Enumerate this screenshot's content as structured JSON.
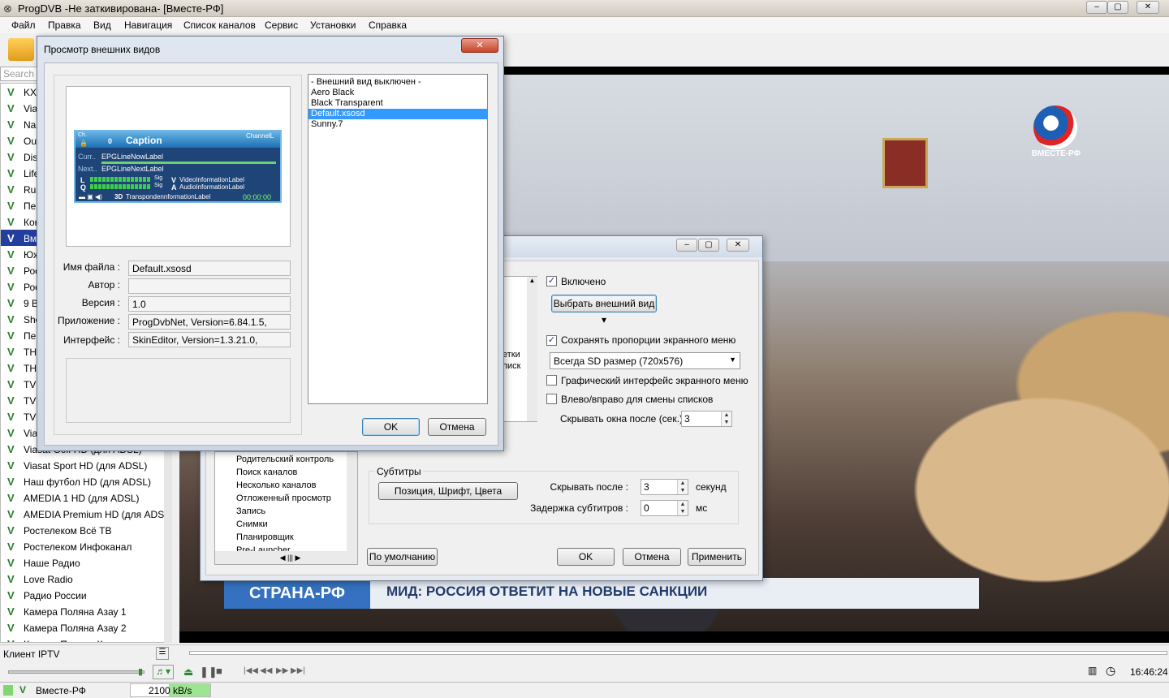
{
  "app": {
    "title": "ProgDVB -Не заткивирована-  [Вместе-РФ]"
  },
  "menu": [
    "Файл",
    "Правка",
    "Вид",
    "Навигация",
    "Список каналов",
    "Сервис",
    "Установки",
    "Справка"
  ],
  "search": {
    "placeholder": "Search c"
  },
  "channels": [
    {
      "name": "KXI"
    },
    {
      "name": "Via"
    },
    {
      "name": "Nau"
    },
    {
      "name": "Out"
    },
    {
      "name": "Dis"
    },
    {
      "name": "Life"
    },
    {
      "name": "Rus"
    },
    {
      "name": "Пер"
    },
    {
      "name": "Кон"
    },
    {
      "name": "Вме",
      "selected": true
    },
    {
      "name": "Юж"
    },
    {
      "name": "Рос"
    },
    {
      "name": "Рос"
    },
    {
      "name": "9 В"
    },
    {
      "name": "Sho"
    },
    {
      "name": "Пер"
    },
    {
      "name": "ТНТ"
    },
    {
      "name": "ТНТ"
    },
    {
      "name": "TV1"
    },
    {
      "name": "TV1"
    },
    {
      "name": "TV1"
    },
    {
      "name": "Via"
    },
    {
      "name": "Viasat Golf HD (для ADSL)"
    },
    {
      "name": "Viasat Sport HD (для ADSL)"
    },
    {
      "name": "Наш футбол HD (для ADSL)"
    },
    {
      "name": "AMEDIA 1 HD (для ADSL)"
    },
    {
      "name": "AMEDIA Premium HD (для ADS.."
    },
    {
      "name": "Ростелеком Всё ТВ"
    },
    {
      "name": "Ростелеком Инфоканал"
    },
    {
      "name": "Наше Радио"
    },
    {
      "name": "Love Radio"
    },
    {
      "name": "Радио России"
    },
    {
      "name": "Камера Поляна Азау 1"
    },
    {
      "name": "Камера Поляна Азау 2"
    },
    {
      "name": "Камера Поляна К..."
    }
  ],
  "video": {
    "logo": "ВМЕСТЕ-РФ",
    "ticker_left": "СТРАНА-РФ",
    "ticker_right": "МИД: РОССИЯ ОТВЕТИТ НА НОВЫЕ САНКЦИИ"
  },
  "bottom": {
    "source": "Клиент IPTV",
    "clock": "16:46:24",
    "channel": "Вместе-РФ",
    "bitrate": "2100 kB/s"
  },
  "skin_dialog": {
    "title": "Просмотр внешних видов",
    "close": "✕",
    "osd": {
      "ch": "Ch.",
      "num": "0",
      "caption": "Caption",
      "channel": "ChannelL",
      "curr": "Curr..",
      "now": "EPGLineNowLabel",
      "next": "Next..",
      "next_label": "EPGLineNextLabel",
      "vinfo": "VideoInformationLabel",
      "ainfo": "AudioInformationLabel",
      "tinfo": "TranspondennformationLabel",
      "time": "00:00:00",
      "sig": "Sig",
      "l": "L",
      "q": "Q",
      "v": "V",
      "a": "A",
      "d3": "3D"
    },
    "fields": {
      "filename_label": "Имя файла :",
      "filename": "Default.xsosd",
      "author_label": "Автор :",
      "author": "",
      "version_label": "Версия :",
      "version": "1.0",
      "app_label": "Приложение :",
      "app": "ProgDvbNet, Version=6.84.1.5,",
      "iface_label": "Интерфейс :",
      "iface": "SkinEditor, Version=1.3.21.0,"
    },
    "skins": [
      "- Внешний вид выключен -",
      "Aero Black",
      "Black Transparent",
      "Default.xsosd",
      "Sunny.7"
    ],
    "selected_skin": 3,
    "ok": "OK",
    "cancel": "Отмена"
  },
  "settings_dialog": {
    "enabled": "Включено",
    "choose_skin": "Выбрать внешний вид",
    "keep_aspect": "Сохранять пропорции экранного меню",
    "size_option": "Всегда SD размер (720x576)",
    "graphic_ui": "Графический интерфейс экранного меню",
    "left_right": "Влево/вправо для смены списков",
    "hide_after_label": "Скрывать окна после (сек.)",
    "hide_after": "3",
    "partial_1": "етки",
    "partial_2": "писк",
    "tree": [
      "Родительский контроль",
      "Поиск каналов",
      "Несколько каналов",
      "Отложенный просмотр",
      "Запись",
      "Снимки",
      "Планировщик",
      "Pre-Launcher"
    ],
    "subtitles_group": "Субтитры",
    "subs_position": "Позиция, Шрифт, Цвета",
    "subs_hide_label": "Скрывать после :",
    "subs_hide": "3",
    "subs_hide_unit": "секунд",
    "subs_delay_label": "Задержка субтитров :",
    "subs_delay": "0",
    "subs_delay_unit": "мс",
    "defaults": "По умолчанию",
    "ok": "OK",
    "cancel": "Отмена",
    "apply": "Применить"
  },
  "colors": {
    "selection": "#3399ff",
    "channel_sel": "#243e9e",
    "osd_bg": "#1f4477"
  }
}
